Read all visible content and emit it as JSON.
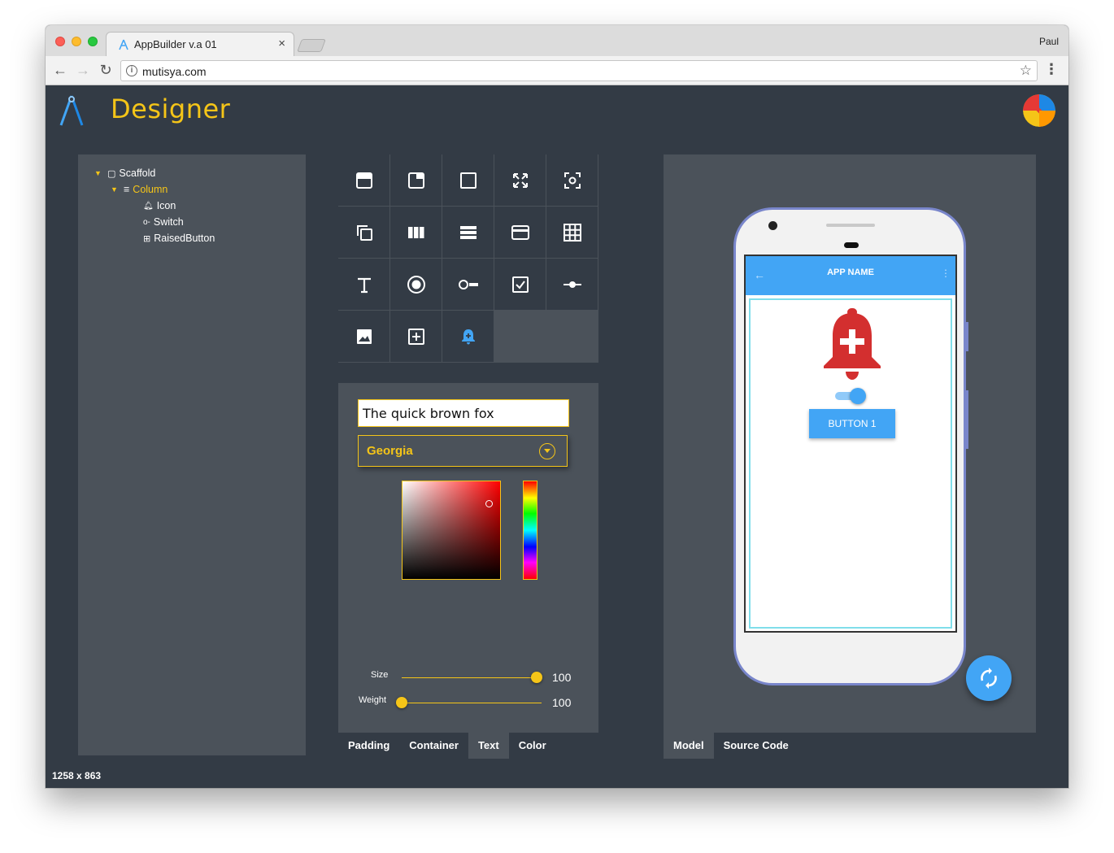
{
  "browser": {
    "tab_title": "AppBuilder v.a 01",
    "tab_close": "×",
    "profile": "Paul",
    "url": "mutisya.com"
  },
  "app": {
    "title": "Designer"
  },
  "tree": {
    "items": [
      {
        "label": "Scaffold",
        "glyph": "▢"
      },
      {
        "label": "Column",
        "glyph": "≡"
      },
      {
        "label": "Icon",
        "glyph": "♫"
      },
      {
        "label": "Switch",
        "glyph": "o-"
      },
      {
        "label": "RaisedButton",
        "glyph": "⊞"
      }
    ]
  },
  "palette": {
    "icons": [
      "appbar-icon",
      "window-icon",
      "square-outline-icon",
      "fullscreen-icon",
      "center-focus-icon",
      "copy-icon",
      "columns-icon",
      "rows-icon",
      "card-icon",
      "grid-icon",
      "text-icon",
      "radio-icon",
      "switch-icon",
      "checkbox-icon",
      "slider-icon",
      "image-icon",
      "add-box-icon",
      "notification-add-icon"
    ]
  },
  "text_props": {
    "sample_text": "The quick brown fox",
    "font": "Georgia",
    "size_label": "Size",
    "size_value": "100",
    "size_fraction": 1.0,
    "weight_label": "Weight",
    "weight_value": "100",
    "weight_fraction": 0.0,
    "selected_color": "#ff0000"
  },
  "prop_tabs": [
    "Padding",
    "Container",
    "Text",
    "Color"
  ],
  "prop_tabs_active": "Text",
  "preview": {
    "app_name": "APP NAME",
    "button_label": "BUTTON 1",
    "switch_on": true,
    "accent": "#42a5f5",
    "bell_color": "#d32f2f"
  },
  "preview_tabs": [
    "Model",
    "Source Code"
  ],
  "preview_tabs_active": "Model",
  "status": {
    "dimensions": "1258 x 863"
  }
}
